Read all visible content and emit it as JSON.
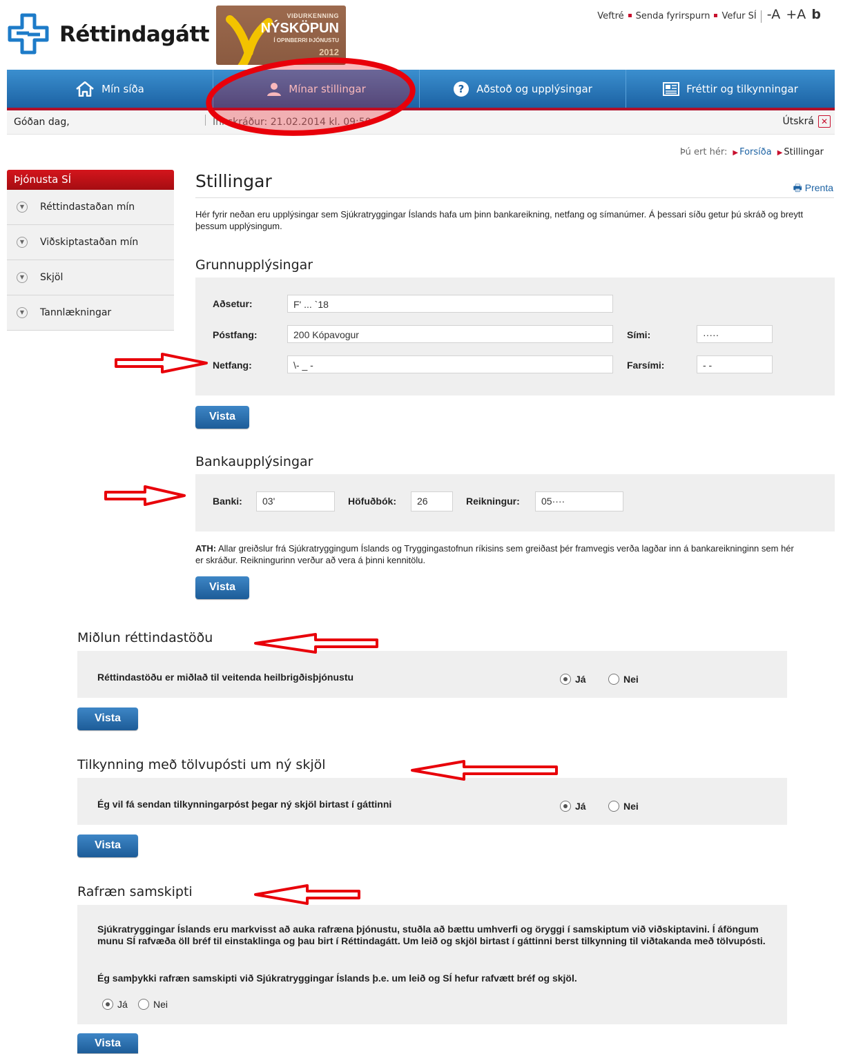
{
  "header": {
    "logo_text": "Réttindagátt",
    "badge": {
      "line1": "VIÐURKENNING",
      "line2": "NÝSKÖPUN",
      "line3": "Í OPINBERRI ÞJÓNUSTU",
      "year": "2012"
    },
    "links": [
      "Veftré",
      "Senda fyrirspurn",
      "Vefur SÍ"
    ],
    "font_decrease": "-A",
    "font_increase": "+A",
    "contrast": "b"
  },
  "nav": {
    "items": [
      {
        "label": "Mín síða",
        "icon": "home-icon"
      },
      {
        "label": "Mínar stillingar",
        "icon": "user-icon"
      },
      {
        "label": "Aðstoð og upplýsingar",
        "icon": "help-icon"
      },
      {
        "label": "Fréttir og tilkynningar",
        "icon": "news-icon"
      }
    ]
  },
  "greeting": {
    "hello": "Góðan dag,",
    "login": "Innskráður: 21.02.2014 kl. 09:50",
    "logout": "Útskrá",
    "logout_icon": "close-icon"
  },
  "breadcrumb": {
    "prefix": "Þú ert hér:",
    "items": [
      "Forsíða",
      "Stillingar"
    ]
  },
  "sidebar": {
    "title": "Þjónusta SÍ",
    "items": [
      "Réttindastaðan mín",
      "Viðskiptastaðan mín",
      "Skjöl",
      "Tannlækningar"
    ]
  },
  "page": {
    "title": "Stillingar",
    "print": "Prenta",
    "intro": "Hér fyrir neðan eru upplýsingar sem Sjúkratryggingar Íslands hafa um þinn bankareikning, netfang og símanúmer. Á þessari síðu getur þú skráð og breytt þessum upplýsingum."
  },
  "basic": {
    "heading": "Grunnupplýsingar",
    "address_label": "Aðsetur:",
    "address_value": "F' ...  `18",
    "postal_label": "Póstfang:",
    "postal_value": "200 Kópavogur",
    "email_label": "Netfang:",
    "email_value": "\\- _ -",
    "phone_label": "Sími:",
    "phone_value": "·····",
    "mobile_label": "Farsími:",
    "mobile_value": "- -",
    "save": "Vista"
  },
  "bank": {
    "heading": "Bankaupplýsingar",
    "bank_label": "Banki:",
    "bank_value": "03'",
    "ledger_label": "Höfuðbók:",
    "ledger_value": "26",
    "account_label": "Reikningur:",
    "account_value": "05····",
    "note_bold": "ATH:",
    "note": "Allar greiðslur frá Sjúkratryggingum Íslands og Tryggingastofnun ríkisins sem greiðast þér framvegis verða lagðar inn á bankareikninginn sem hér er skráður. Reikningurinn verður að vera á þinni kennitölu.",
    "save": "Vista"
  },
  "mediation": {
    "heading": "Miðlun réttindastöðu",
    "text": "Réttindastöðu er miðlað til veitenda heilbrigðisþjónustu",
    "yes": "Já",
    "no": "Nei",
    "selected": "yes",
    "save": "Vista"
  },
  "email_notify": {
    "heading": "Tilkynning með tölvupósti um ný skjöl",
    "text": "Ég vil fá sendan tilkynningarpóst þegar ný skjöl birtast í gáttinni",
    "yes": "Já",
    "no": "Nei",
    "selected": "yes",
    "save": "Vista"
  },
  "electronic": {
    "heading": "Rafræn samskipti",
    "text": "Sjúkratryggingar Íslands eru markvisst að auka rafræna þjónustu, stuðla að bættu umhverfi og öryggi í samskiptum við viðskiptavini. Í áföngum munu SÍ rafvæða öll bréf til einstaklinga og þau birt í Réttindagátt. Um leið og skjöl birtast í gáttinni berst tilkynning til viðtakanda með tölvupósti.",
    "consent": "Ég samþykki rafræn samskipti við Sjúkratryggingar Íslands þ.e. um leið og SÍ hefur rafvætt bréf og skjöl.",
    "yes": "Já",
    "no": "Nei",
    "selected": "yes",
    "save": "Vista"
  },
  "colors": {
    "nav_blue": "#1c62a3",
    "accent_red": "#c8102e",
    "annotation_red": "#e8000a"
  }
}
